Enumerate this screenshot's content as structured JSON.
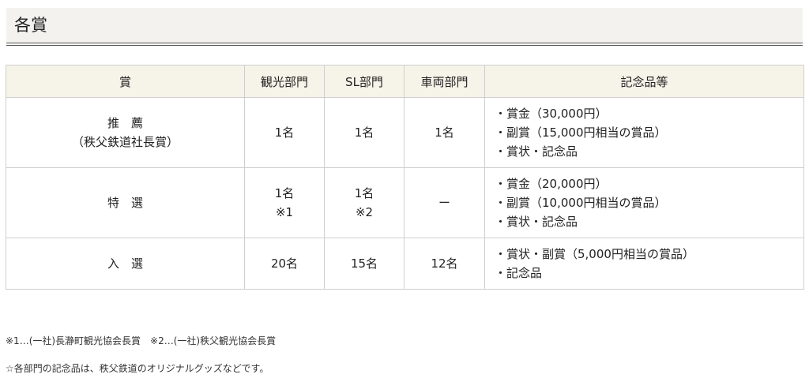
{
  "section": {
    "title": "各賞"
  },
  "table": {
    "headers": [
      "賞",
      "観光部門",
      "SL部門",
      "車両部門",
      "記念品等"
    ],
    "rows": [
      {
        "award": [
          "推　薦",
          "（秩父鉄道社長賞）"
        ],
        "tourism": [
          "1名"
        ],
        "sl": [
          "1名"
        ],
        "vehicle": [
          "1名"
        ],
        "prizes": [
          "・賞金（30,000円）",
          "・副賞（15,000円相当の賞品）",
          "・賞状・記念品"
        ]
      },
      {
        "award": [
          "特　選"
        ],
        "tourism": [
          "1名",
          "※1"
        ],
        "sl": [
          "1名",
          "※2"
        ],
        "vehicle": [
          "ー"
        ],
        "prizes": [
          "・賞金（20,000円）",
          "・副賞（10,000円相当の賞品）",
          "・賞状・記念品"
        ]
      },
      {
        "award": [
          "入　選"
        ],
        "tourism": [
          "20名"
        ],
        "sl": [
          "15名"
        ],
        "vehicle": [
          "12名"
        ],
        "prizes": [
          "・賞状・副賞（5,000円相当の賞品）",
          "・記念品"
        ]
      }
    ]
  },
  "footnotes": [
    "※1…(一社)長瀞町観光協会長賞　※2…(一社)秩父観光協会長賞",
    "☆各部門の記念品は、秩父鉄道のオリジナルグッズなどです。"
  ]
}
